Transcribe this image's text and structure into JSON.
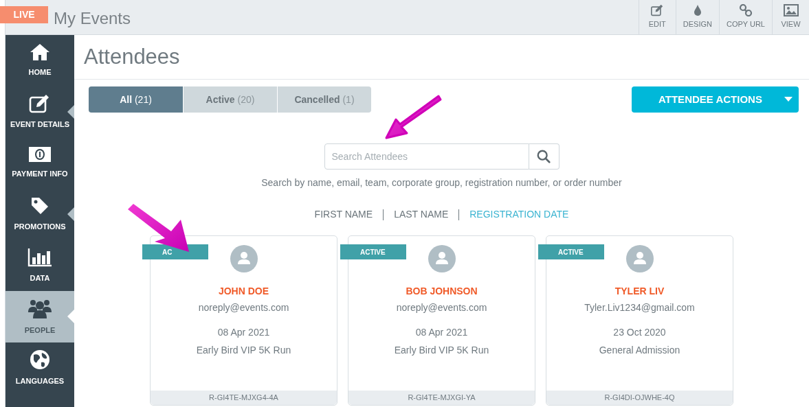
{
  "header": {
    "badge": "LIVE",
    "title": "My Events",
    "tools": [
      {
        "kind": "edit",
        "label": "EDIT"
      },
      {
        "kind": "design",
        "label": "DESIGN"
      },
      {
        "kind": "link",
        "label": "COPY URL"
      },
      {
        "kind": "image",
        "label": "VIEW"
      }
    ]
  },
  "sidebar": {
    "items": [
      {
        "kind": "home",
        "label": "HOME",
        "selected": false,
        "submenu": false
      },
      {
        "kind": "edit",
        "label": "EVENT DETAILS",
        "selected": false,
        "submenu": true
      },
      {
        "kind": "money",
        "label": "PAYMENT INFO",
        "selected": false,
        "submenu": false
      },
      {
        "kind": "tag",
        "label": "PROMOTIONS",
        "selected": false,
        "submenu": true
      },
      {
        "kind": "chart",
        "label": "DATA",
        "selected": false,
        "submenu": false
      },
      {
        "kind": "people",
        "label": "PEOPLE",
        "selected": true,
        "submenu": true
      },
      {
        "kind": "globe",
        "label": "LANGUAGES",
        "selected": false,
        "submenu": false
      }
    ]
  },
  "page_title": "Attendees",
  "filter_tabs": [
    {
      "label": "All",
      "count": "(21)",
      "selected": true
    },
    {
      "label": "Active",
      "count": "(20)",
      "selected": false
    },
    {
      "label": "Cancelled",
      "count": "(1)",
      "selected": false
    }
  ],
  "actions_button": "ATTENDEE ACTIONS",
  "search": {
    "placeholder": "Search Attendees",
    "hint": "Search by name, email, team, corporate group, registration number, or order number"
  },
  "sort_options": [
    {
      "label": "FIRST NAME",
      "selected": false
    },
    {
      "label": "LAST NAME",
      "selected": false
    },
    {
      "label": "REGISTRATION DATE",
      "selected": true
    }
  ],
  "attendees": [
    {
      "status": "AC",
      "name": "JOHN DOE",
      "email": "noreply@events.com",
      "date": "08 Apr 2021",
      "ticket": "Early Bird VIP 5K Run",
      "registration": "R-GI4TE-MJXG4-4A"
    },
    {
      "status": "ACTIVE",
      "name": "BOB JOHNSON",
      "email": "noreply@events.com",
      "date": "08 Apr 2021",
      "ticket": "Early Bird VIP 5K Run",
      "registration": "R-GI4TE-MJXGI-YA"
    },
    {
      "status": "ACTIVE",
      "name": "TYLER LIV",
      "email": "Tyler.Liv1234@gmail.com",
      "date": "23 Oct 2020",
      "ticket": "General Admission",
      "registration": "R-GI4DI-OJWHE-4Q"
    }
  ]
}
